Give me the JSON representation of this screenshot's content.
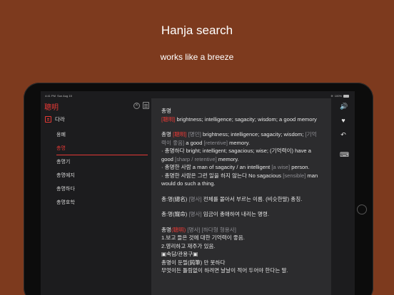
{
  "promo": {
    "title": "Hanja search",
    "subtitle": "works like a breeze"
  },
  "status_bar": {
    "time": "4:41 PM",
    "date": "Sun Aug 15",
    "battery": "100%"
  },
  "sidebar": {
    "search_value": "聰明",
    "header_label": "다라",
    "items": [
      {
        "label": "옹폐",
        "selected": false
      },
      {
        "label": "총명",
        "selected": true
      },
      {
        "label": "총명기",
        "selected": false
      },
      {
        "label": "총명예지",
        "selected": false
      },
      {
        "label": "총명하다",
        "selected": false
      },
      {
        "label": "총명호학",
        "selected": false
      }
    ]
  },
  "content": {
    "headword": "총명",
    "def1_hanja": "[聰明]",
    "def1_text": " brightness; intelligence; sagacity; wisdom; a good memory",
    "def2": {
      "word": "총명 ",
      "hanja": "[聰明]",
      "pos": " [명민]",
      "text": " brightness; intelligence; sagacity; wisdom;",
      "note1": "[기억력이 좋음]",
      "text2": " a good ",
      "note2": "[retentive]",
      "text3": " memory."
    },
    "ex1_text": "· 총명하다 bright; intelligent; sagacious; wise; (기억력이) have a good ",
    "ex1_note": "[sharp / retentive]",
    "ex1_end": " memory.",
    "ex2_text": "· 총명한 사람 a man of sagacity / an intelligent ",
    "ex2_note": "[a wise]",
    "ex2_end": " person.",
    "ex3_text": "· 총명한 사람은 그런 일을 하지 않는다 No sagacious ",
    "ex3_note": "[sensible]",
    "ex3_end": " man would do such a thing.",
    "entry2_word": "총:명(總名)",
    "entry2_pos": " [명사]",
    "entry2_text": " 전체를 몰아서 부르는 이름. (비슷한말) 총칭.",
    "entry3_word": "총:명(寵命)",
    "entry3_pos": " [명사]",
    "entry3_text": " 임금이 총애하여 내리는 명령.",
    "entry4_word": "총명",
    "entry4_hanja": "(聰明)",
    "entry4_pos": " [명사] [하다형 형용사]",
    "entry4_line1": "1.보고 들은 것에 대한 기억력이 좋음.",
    "entry4_line2": "2.영리하고 재주가 있음.",
    "entry4_line3": "▣속담/관용구▣",
    "entry4_line4": "총명이 둔필(鈍筆) 만 못하다",
    "entry4_line5": "무엇이든 틀림없이 하려면 날날이 적어 두어야 한다는 말."
  },
  "rail": {
    "speaker": "🔊",
    "heart": "♥",
    "back": "↶",
    "keyboard": "⌨"
  }
}
